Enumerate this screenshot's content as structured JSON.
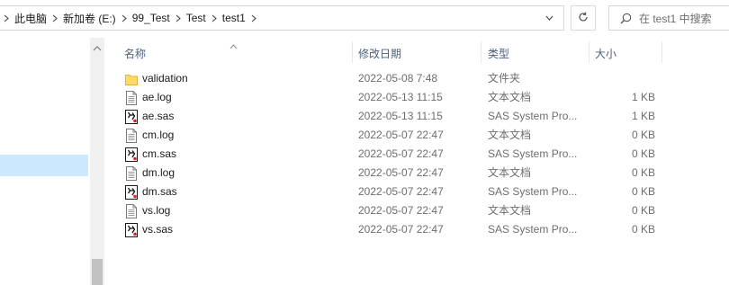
{
  "address_bar": {
    "crumbs": [
      "此电脑",
      "新加卷 (E:)",
      "99_Test",
      "Test",
      "test1"
    ]
  },
  "search": {
    "placeholder": "在 test1 中搜索"
  },
  "columns": {
    "name": "名称",
    "date": "修改日期",
    "type": "类型",
    "size": "大小"
  },
  "files": [
    {
      "name": "validation",
      "date": "2022-05-08 7:48",
      "type": "文件夹",
      "size": "",
      "icon": "folder-icon"
    },
    {
      "name": "ae.log",
      "date": "2022-05-13 11:15",
      "type": "文本文档",
      "size": "1 KB",
      "icon": "text-file-icon"
    },
    {
      "name": "ae.sas",
      "date": "2022-05-13 11:15",
      "type": "SAS System Pro...",
      "size": "1 KB",
      "icon": "sas-file-icon"
    },
    {
      "name": "cm.log",
      "date": "2022-05-07 22:47",
      "type": "文本文档",
      "size": "0 KB",
      "icon": "text-file-icon"
    },
    {
      "name": "cm.sas",
      "date": "2022-05-07 22:47",
      "type": "SAS System Pro...",
      "size": "0 KB",
      "icon": "sas-file-icon"
    },
    {
      "name": "dm.log",
      "date": "2022-05-07 22:47",
      "type": "文本文档",
      "size": "0 KB",
      "icon": "text-file-icon"
    },
    {
      "name": "dm.sas",
      "date": "2022-05-07 22:47",
      "type": "SAS System Pro...",
      "size": "0 KB",
      "icon": "sas-file-icon"
    },
    {
      "name": "vs.log",
      "date": "2022-05-07 22:47",
      "type": "文本文档",
      "size": "0 KB",
      "icon": "text-file-icon"
    },
    {
      "name": "vs.sas",
      "date": "2022-05-07 22:47",
      "type": "SAS System Pro...",
      "size": "0 KB",
      "icon": "sas-file-icon"
    }
  ],
  "colors": {
    "header_text": "#4c607a",
    "selection": "#cce8ff",
    "folder": "#ffd96a"
  }
}
